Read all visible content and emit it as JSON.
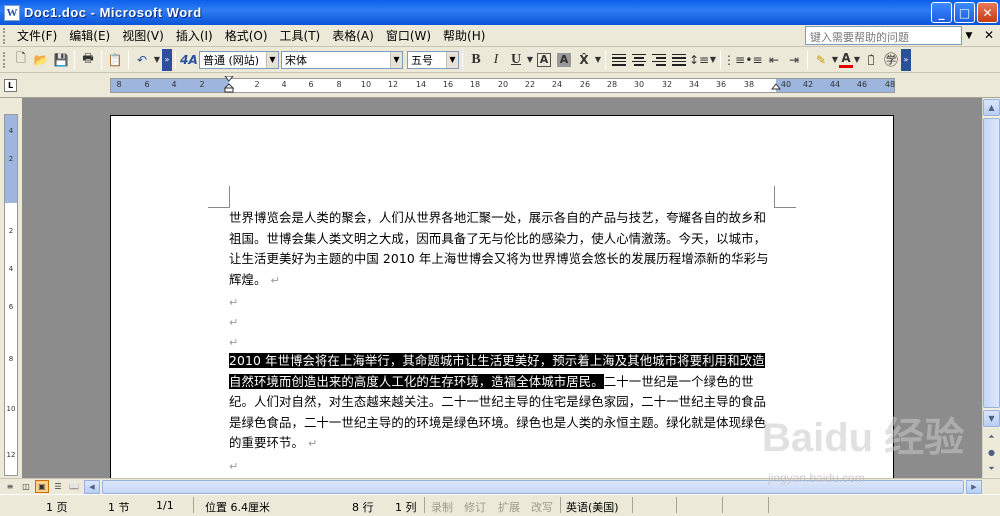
{
  "window": {
    "title": "Doc1.doc - Microsoft Word",
    "icon_letter": "W"
  },
  "menu": {
    "items": [
      "文件(F)",
      "编辑(E)",
      "视图(V)",
      "插入(I)",
      "格式(O)",
      "工具(T)",
      "表格(A)",
      "窗口(W)",
      "帮助(H)"
    ],
    "help_placeholder": "键入需要帮助的问题"
  },
  "toolbar": {
    "style": "普通 (网站)",
    "font": "宋体",
    "size": "五号"
  },
  "ruler": {
    "h_labels": [
      "8",
      "6",
      "4",
      "2",
      "2",
      "4",
      "6",
      "8",
      "10",
      "12",
      "14",
      "16",
      "18",
      "20",
      "22",
      "24",
      "26",
      "28",
      "30",
      "32",
      "34",
      "36",
      "38",
      "40",
      "42",
      "44",
      "46",
      "48"
    ],
    "v_labels": [
      "4",
      "2",
      "2",
      "4",
      "6",
      "8",
      "10",
      "12"
    ],
    "tab_marker": "L"
  },
  "document": {
    "para1": "世界博览会是人类的聚会，人们从世界各地汇聚一处，展示各自的产品与技艺，夸耀各自的故乡和祖国。世博会集人类文明之大成，因而具备了无与伦比的感染力，使人心情激荡。今天，以城市，让生活更美好为主题的中国 2010 年上海世博会又将为世界博览会悠长的发展历程增添新的华彩与辉煌。",
    "para_mark": "↵",
    "para2_selected": "2010 年世博会将在上海举行，其命题城市让生活更美好，预示着上海及其他城市将要利用和改造自然环境而创造出来的高度人工化的生存环境，造福全体城市居民。",
    "para2_rest": "二十一世纪是一个绿色的世纪。人们对自然，对生态越来越关注。二十一世纪主导的住宅是绿色家园，二十一世纪主导的食品是绿色食品，二十一世纪主导的的环境是绿色环境。绿色也是人类的永恒主题。绿化就是体现绿色的重要环节。"
  },
  "status": {
    "page": "1 页",
    "section": "1 节",
    "pages": "1/1",
    "position": "位置 6.4厘米",
    "line": "8 行",
    "column": "1 列",
    "rec": "录制",
    "trk": "修订",
    "ext": "扩展",
    "ovr": "改写",
    "language": "英语(美国)"
  },
  "watermark": {
    "logo": "Baidu 经验",
    "url": "jingyan.baidu.com"
  },
  "colors": {
    "titlebar": "#0a5fe8",
    "selection": "#000000",
    "ruler_margin": "#9eb6de"
  }
}
